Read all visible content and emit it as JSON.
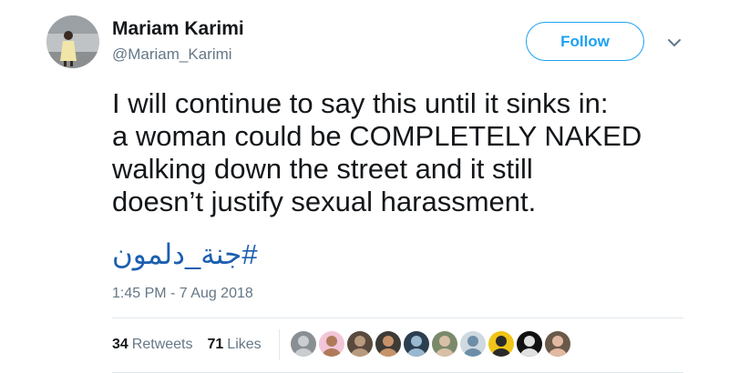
{
  "author": {
    "display_name": "Mariam Karimi",
    "handle": "@Mariam_Karimi"
  },
  "follow_label": "Follow",
  "tweet": {
    "text_lines": [
      "I will continue to say this until it sinks in:",
      "a woman could be COMPLETELY NAKED",
      "walking down the street and it still",
      "doesn’t justify sexual harassment."
    ],
    "hashtag": "#جنة_دلمون",
    "timestamp": "1:45 PM - 7 Aug 2018"
  },
  "stats": {
    "retweets_count": "34",
    "retweets_label": "Retweets",
    "likes_count": "71",
    "likes_label": "Likes"
  },
  "icons": {
    "caret": "chevron-down-icon",
    "avatar": "avatar"
  },
  "colors": {
    "accent": "#1da1f2",
    "hashtag": "#1b5fb0",
    "muted": "#657786",
    "divider": "#e1e8ed"
  },
  "liker_avatars": [
    {
      "name": "liker-avatar-1",
      "bg": "#8a8f93",
      "fg": "#c9cdd0"
    },
    {
      "name": "liker-avatar-2",
      "bg": "#f2c6d8",
      "fg": "#b07a5a"
    },
    {
      "name": "liker-avatar-3",
      "bg": "#5a4a3e",
      "fg": "#b89a7e"
    },
    {
      "name": "liker-avatar-4",
      "bg": "#3e3a36",
      "fg": "#c7926a"
    },
    {
      "name": "liker-avatar-5",
      "bg": "#2c3e50",
      "fg": "#9ab8d0"
    },
    {
      "name": "liker-avatar-6",
      "bg": "#7a8a6a",
      "fg": "#d8c0a6"
    },
    {
      "name": "liker-avatar-7",
      "bg": "#cfd9e0",
      "fg": "#6d8ea8"
    },
    {
      "name": "liker-avatar-8",
      "bg": "#f0c419",
      "fg": "#2a2a2a"
    },
    {
      "name": "liker-avatar-9",
      "bg": "#111111",
      "fg": "#e0e0e0"
    },
    {
      "name": "liker-avatar-10",
      "bg": "#6a5a4a",
      "fg": "#e2b8a0"
    }
  ]
}
